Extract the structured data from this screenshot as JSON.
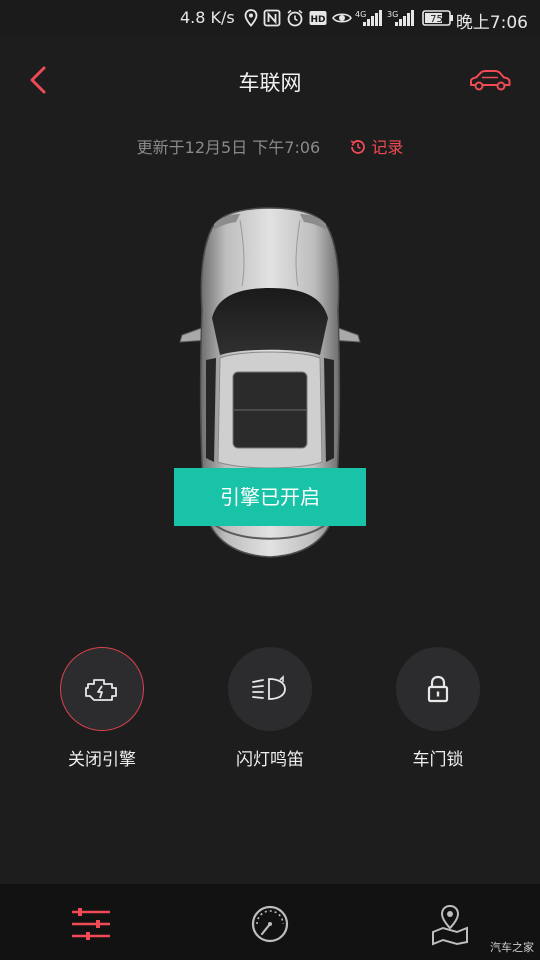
{
  "status_bar": {
    "speed": "4.8 K/s",
    "network_4g_label": "4G",
    "network_3g_label": "3G",
    "battery": "75",
    "time": "晚上7:06",
    "icons": [
      "location-icon",
      "nfc-icon",
      "alarm-icon",
      "hd-icon",
      "eye-icon",
      "signal-4g-icon",
      "signal-3g-icon",
      "battery-icon"
    ]
  },
  "header": {
    "title": "车联网",
    "back_icon": "chevron-left-icon",
    "car_icon": "car-icon"
  },
  "update": {
    "text": "更新于12月5日 下午7:06",
    "record_label": "记录",
    "record_icon": "history-icon"
  },
  "engine_status": "引擎已开启",
  "controls": [
    {
      "label": "关闭引擎",
      "icon": "engine-icon",
      "active": true
    },
    {
      "label": "闪灯鸣笛",
      "icon": "headlight-horn-icon",
      "active": false
    },
    {
      "label": "车门锁",
      "icon": "lock-icon",
      "active": false
    }
  ],
  "bottom_nav": [
    {
      "icon": "sliders-icon",
      "active": true
    },
    {
      "icon": "speedometer-icon",
      "active": false
    },
    {
      "icon": "map-pin-icon",
      "active": false
    }
  ],
  "watermark": "汽车之家",
  "colors": {
    "accent_red": "#f04a54",
    "teal": "#19c3a8",
    "background": "#1d1d1e",
    "circle": "#2c2c2e"
  }
}
